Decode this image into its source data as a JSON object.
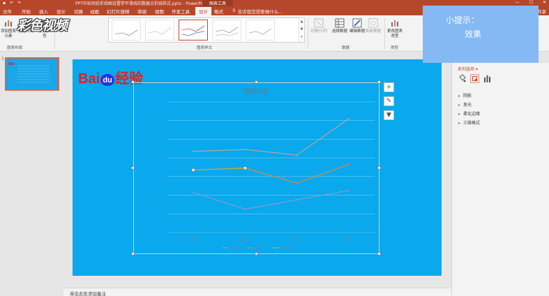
{
  "app": {
    "doc_title": "PPT中如何给折线图设置带平滑线的数据点折线样式.pptx - PowerPoint",
    "context_tab": "图表工具",
    "window_buttons": [
      "—",
      "☐",
      "✕"
    ]
  },
  "menu": {
    "tabs": [
      "文件",
      "开始",
      "插入",
      "设计",
      "切换",
      "动画",
      "幻灯片放映",
      "审阅",
      "视图",
      "开发工具",
      "设计",
      "格式"
    ],
    "active_tab_index": 10,
    "tell_me": "告诉我您想要做什么...",
    "share": "共享"
  },
  "ribbon": {
    "add_element": "添加图表元素",
    "quick_layout": "快速布局",
    "change_colors": "更改颜色",
    "switch_rowcol": "切换行/列",
    "select_data": "选择数据",
    "edit_data": "编辑数据",
    "refresh_data": "刷新数据",
    "change_type": "更改图表类型",
    "groups": {
      "layouts": "图表布局",
      "styles": "图表样式",
      "data": "数据",
      "type": "类型"
    }
  },
  "watermark": "彩色视频",
  "tip": {
    "line1": "小提示：",
    "line2": "效果"
  },
  "slide_panel": {
    "slide_number": "1"
  },
  "slide": {
    "logo_left": "Bai",
    "logo_du": "du",
    "logo_right": "经验"
  },
  "chart_data": {
    "type": "line",
    "title": "图表标题",
    "categories": [
      "类别 1",
      "类别 2",
      "类别 3",
      "类别 4"
    ],
    "series": [
      {
        "name": "系列 1",
        "values": [
          4.3,
          2.5,
          3.5,
          4.5
        ],
        "color": "#7f9bd8"
      },
      {
        "name": "系列 2",
        "values": [
          6.7,
          6.9,
          5.3,
          7.3
        ],
        "color": "#d08a4d"
      },
      {
        "name": "系列 3",
        "values": [
          8.7,
          8.9,
          8.3,
          12.2
        ],
        "color": "#a7a7a7"
      }
    ],
    "ylim": [
      0,
      14
    ],
    "yticks": [
      0,
      2,
      4,
      6,
      8,
      10,
      12,
      14
    ],
    "grid": true,
    "legend": "bottom",
    "colors": {
      "background": "#0aa8ec",
      "gridline": "#6fd0f5",
      "axis_text": "#5a8fb0"
    }
  },
  "notes": {
    "placeholder": "单击此处添加备注"
  },
  "format_pane": {
    "series_selector": "系列选项 ▾",
    "sections": [
      "阴影",
      "发光",
      "柔化边缘",
      "三维格式"
    ]
  },
  "colors": {
    "accent": "#b7472a",
    "tip_bg": "#85b9f4",
    "slide_bg": "#0aa8ec"
  }
}
